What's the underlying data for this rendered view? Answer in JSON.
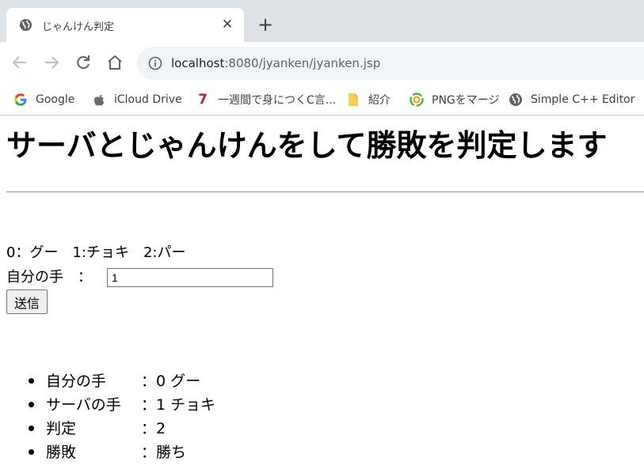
{
  "browser": {
    "tab_title": "じゃんけん判定",
    "close_glyph": "✕",
    "newtab_glyph": "+",
    "url_host": "localhost",
    "url_path": ":8080/jyanken/jyanken.jsp",
    "bookmarks": [
      {
        "label": "Google",
        "icon": "google-icon"
      },
      {
        "label": "iCloud Drive",
        "icon": "apple-icon"
      },
      {
        "label": "一週間で身につくC言...",
        "icon": "seven-icon"
      },
      {
        "label": "紹介",
        "icon": "folder-icon"
      },
      {
        "label": "PNGをマージ",
        "icon": "png-icon"
      },
      {
        "label": "Simple C++ Editor",
        "icon": "globe-icon"
      }
    ]
  },
  "page": {
    "heading": "サーバとじゃんけんをして勝敗を判定します",
    "legend": "0：グー　1:チョキ　2:パー",
    "hand_label": "自分の手　：",
    "hand_value": "1",
    "submit_label": "送信",
    "results": [
      {
        "label": "自分の手",
        "value": "：0 グー"
      },
      {
        "label": "サーバの手",
        "value": "：1 チョキ"
      },
      {
        "label": "判定",
        "value": "：2"
      },
      {
        "label": "勝敗",
        "value": "：勝ち"
      }
    ]
  },
  "colors": {
    "tabstrip": "#dee1e6",
    "omnibox": "#f1f3f4",
    "google_blue": "#4285f4",
    "seven_red": "#c2185b",
    "folder_yellow": "#f6cf57"
  }
}
